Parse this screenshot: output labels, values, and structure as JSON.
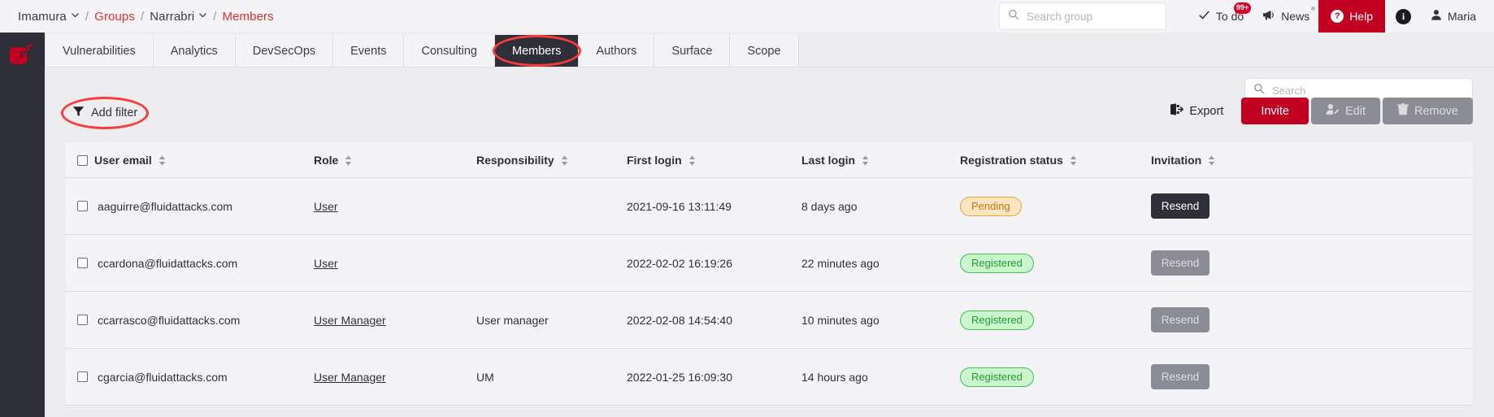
{
  "breadcrumb": {
    "org": "Imamura",
    "groups": "Groups",
    "group": "Narrabri",
    "current": "Members",
    "sep": "/"
  },
  "header": {
    "search_placeholder": "Search group",
    "search_value": "",
    "todo_label": "To do",
    "todo_badge": "99+",
    "news_label": "News",
    "help_label": "Help",
    "help_icon_char": "?",
    "info_icon_char": "i",
    "user_name": "Maria"
  },
  "tabs": [
    {
      "label": "Vulnerabilities",
      "active": false
    },
    {
      "label": "Analytics",
      "active": false
    },
    {
      "label": "DevSecOps",
      "active": false
    },
    {
      "label": "Events",
      "active": false
    },
    {
      "label": "Consulting",
      "active": false
    },
    {
      "label": "Members",
      "active": true
    },
    {
      "label": "Authors",
      "active": false
    },
    {
      "label": "Surface",
      "active": false
    },
    {
      "label": "Scope",
      "active": false
    }
  ],
  "toolbar": {
    "table_search_placeholder": "Search",
    "table_search_value": "",
    "add_filter_label": "Add filter",
    "export_label": "Export",
    "invite_label": "Invite",
    "edit_label": "Edit",
    "remove_label": "Remove"
  },
  "table": {
    "columns": [
      {
        "key": "email",
        "label": "User email"
      },
      {
        "key": "role",
        "label": "Role"
      },
      {
        "key": "responsibility",
        "label": "Responsibility"
      },
      {
        "key": "first_login",
        "label": "First login"
      },
      {
        "key": "last_login",
        "label": "Last login"
      },
      {
        "key": "registration_status",
        "label": "Registration status"
      },
      {
        "key": "invitation",
        "label": "Invitation"
      }
    ],
    "rows": [
      {
        "email": "aaguirre@fluidattacks.com",
        "role": "User",
        "responsibility": "",
        "first_login": "2021-09-16 13:11:49",
        "last_login": "8 days ago",
        "registration_status": "Pending",
        "status_kind": "pending",
        "invitation_label": "Resend",
        "invitation_enabled": true
      },
      {
        "email": "ccardona@fluidattacks.com",
        "role": "User",
        "responsibility": "",
        "first_login": "2022-02-02 16:19:26",
        "last_login": "22 minutes ago",
        "registration_status": "Registered",
        "status_kind": "registered",
        "invitation_label": "Resend",
        "invitation_enabled": false
      },
      {
        "email": "ccarrasco@fluidattacks.com",
        "role": "User Manager",
        "responsibility": "User manager",
        "first_login": "2022-02-08 14:54:40",
        "last_login": "10 minutes ago",
        "registration_status": "Registered",
        "status_kind": "registered",
        "invitation_label": "Resend",
        "invitation_enabled": false
      },
      {
        "email": "cgarcia@fluidattacks.com",
        "role": "User Manager",
        "responsibility": "UM",
        "first_login": "2022-01-25 16:09:30",
        "last_login": "14 hours ago",
        "registration_status": "Registered",
        "status_kind": "registered",
        "invitation_label": "Resend",
        "invitation_enabled": false
      }
    ]
  },
  "colors": {
    "brand_red": "#c20022",
    "annotation_red": "#fb3b3b",
    "dark": "#2f2f3a",
    "pending_text": "#c4761a",
    "registered_text": "#249c38"
  }
}
